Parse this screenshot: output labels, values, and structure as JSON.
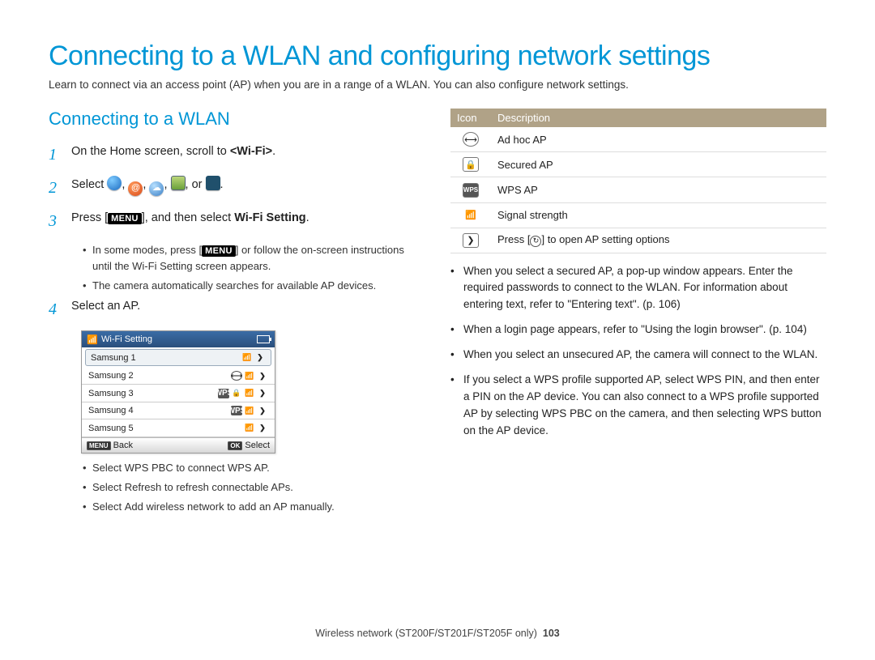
{
  "title": "Connecting to a WLAN and configuring network settings",
  "intro": "Learn to connect via an access point (AP) when you are in a range of a WLAN. You can also configure network settings.",
  "section_heading": "Connecting to a WLAN",
  "steps": {
    "1": {
      "text_pre": "On the Home screen, scroll to ",
      "text_bold": "<Wi-Fi>",
      "text_post": "."
    },
    "2": {
      "text_pre": "Select ",
      "text_post": "."
    },
    "3": {
      "text_pre": "Press [",
      "menu": "MENU",
      "mid": "], and then select ",
      "bold": "Wi-Fi Setting",
      "post": "."
    },
    "3sub": {
      "a_pre": "In some modes, press [",
      "a_menu": "MENU",
      "a_post": "] or follow the on-screen instructions until the Wi-Fi Setting screen appears.",
      "b": "The camera automatically searches for available AP devices."
    },
    "4": "Select an AP.",
    "4sub": {
      "a_pre": "Select ",
      "a_b": "WPS PBC",
      "a_post": " to connect WPS AP.",
      "b_pre": "Select ",
      "b_b": "Refresh",
      "b_post": " to refresh connectable APs.",
      "c_pre": "Select ",
      "c_b": "Add wireless network",
      "c_post": " to add an AP manually."
    }
  },
  "device": {
    "title": "Wi-Fi Setting",
    "rows": [
      {
        "name": "Samsung 1",
        "icons": [
          "sig",
          "chev"
        ],
        "sel": true
      },
      {
        "name": "Samsung 2",
        "icons": [
          "adhoc",
          "sig",
          "chev"
        ]
      },
      {
        "name": "Samsung 3",
        "icons": [
          "wps",
          "lock",
          "sig",
          "chev"
        ]
      },
      {
        "name": "Samsung 4",
        "icons": [
          "wps",
          "sig",
          "chev"
        ]
      },
      {
        "name": "Samsung 5",
        "icons": [
          "sig",
          "chev"
        ]
      }
    ],
    "footer": {
      "back_btn": "MENU",
      "back": "Back",
      "ok_btn": "OK",
      "select": "Select"
    }
  },
  "icon_table": {
    "head": {
      "c1": "Icon",
      "c2": "Description"
    },
    "rows": [
      {
        "icon": "adhoc",
        "label": "Ad hoc AP"
      },
      {
        "icon": "lock",
        "label": "Secured AP"
      },
      {
        "icon": "wps",
        "label": "WPS AP"
      },
      {
        "icon": "signal",
        "label": "Signal strength"
      },
      {
        "icon": "chev",
        "label_pre": "Press [",
        "label_mid_icon": "reload",
        "label_post": "] to open AP setting options"
      }
    ]
  },
  "notes": {
    "n1": "When you select a secured AP, a pop-up window appears. Enter the required passwords to connect to the WLAN. For information about entering text, refer to \"Entering text\". (p. 106)",
    "n2": "When a login page appears, refer to \"Using the login browser\". (p. 104)",
    "n3": "When you select an unsecured AP, the camera will connect to the WLAN.",
    "n4_pre": "If you select a WPS profile supported AP, select ",
    "n4_b1": "WPS PIN",
    "n4_mid": ", and then enter a PIN on the AP device. You can also connect to a WPS profile supported AP by selecting ",
    "n4_b2": "WPS PBC",
    "n4_mid2": " on the camera, and then selecting ",
    "n4_b3": "WPS",
    "n4_post": " button on the AP device."
  },
  "footer": {
    "text": "Wireless network (ST200F/ST201F/ST205F only)",
    "page": "103"
  }
}
